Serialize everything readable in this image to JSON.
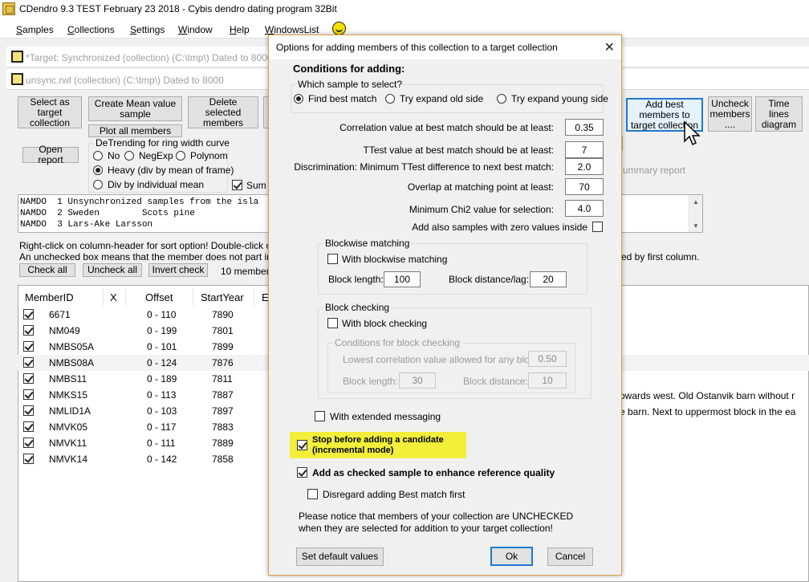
{
  "window": {
    "title": "CDendro 9.3  TEST February 23 2018 - Cybis dendro dating program  32Bit"
  },
  "menu": [
    "Samples",
    "Collections",
    "Settings",
    "Window",
    "Help",
    "WindowsList"
  ],
  "mdi": {
    "target_title": "*Target: Synchronized (collection)  (C:\\tmp\\) Dated to 8000",
    "unsync_title": "unsync.rwl (collection)  (C:\\tmp\\) Dated to 8000"
  },
  "toolbar": {
    "select_target": "Select as target collection",
    "create_mean": "Create Mean value sample",
    "plot_all": "Plot all members",
    "delete_selected": "Delete selected members",
    "open_report": "Open report",
    "add_best": "Add best members to target collection",
    "uncheck_members": "Uncheck members ....",
    "time_lines": "Time lines diagram",
    "summary_report": "ummary report",
    "sum_checkbox": "Sum b"
  },
  "detrending": {
    "title": "DeTrending for ring width curve",
    "no": "No",
    "negexp": "NegExp",
    "polynom": "Polynom",
    "heavy": "Heavy (div by mean of frame)",
    "div_individual": "Div by individual mean"
  },
  "info_lines": [
    "NAMDO  1 Unsynchronized samples from the isla",
    "NAMDO  2 Sweden        Scots pine",
    "NAMDO  3 Lars-Ake Larsson"
  ],
  "hints": {
    "line1": "Right-click on column-header for sort option! Double-click on a me",
    "line2": "An unchecked box means that the member does not part in calcula",
    "right_hint": "ed by first column."
  },
  "list_buttons": {
    "check_all": "Check all",
    "uncheck_all": "Uncheck all",
    "invert_check": "Invert check",
    "members_count": "10 members,"
  },
  "columns": [
    "MemberID",
    "X",
    "Offset",
    "StartYear",
    "E"
  ],
  "members": [
    {
      "id": "6671",
      "offset": "0 - 110",
      "start": "7890"
    },
    {
      "id": "NM049",
      "offset": "0 - 199",
      "start": "7801"
    },
    {
      "id": "NMBS05A",
      "offset": "0 - 101",
      "start": "7899"
    },
    {
      "id": "NMBS08A",
      "offset": "0 - 124",
      "start": "7876"
    },
    {
      "id": "NMBS11",
      "offset": "0 - 189",
      "start": "7811"
    },
    {
      "id": "NMKS15",
      "offset": "0 - 113",
      "start": "7887"
    },
    {
      "id": "NMLID1A",
      "offset": "0 - 103",
      "start": "7897"
    },
    {
      "id": "NMVK05",
      "offset": "0 - 117",
      "start": "7883"
    },
    {
      "id": "NMVK11",
      "offset": "0 - 111",
      "start": "7889"
    },
    {
      "id": "NMVK14",
      "offset": "0 - 142",
      "start": "7858"
    }
  ],
  "bg_text": {
    "line1": "owards west. Old Ostanvik barn without r",
    "line2": "e barn. Next to uppermost block in the ea"
  },
  "dialog": {
    "title": "Options for adding members of this collection to a target collection",
    "close": "✕",
    "conditions_header": "Conditions for adding:",
    "which_sample": "Which sample to select?",
    "opt_best": "Find best match",
    "opt_old": "Try expand old side",
    "opt_young": "Try expand young side",
    "corr_label": "Correlation value at best match should be at least:",
    "corr_value": "0.35",
    "ttest_label": "TTest value at best match should be at least:",
    "ttest_value": "7",
    "discr_label": "Discrimination: Minimum TTest difference to next best match:",
    "discr_value": "2.0",
    "overlap_label": "Overlap at matching point at least:",
    "overlap_value": "70",
    "chi2_label": "Minimum Chi2 value for selection:",
    "chi2_value": "4.0",
    "zero_values": "Add also samples with zero values inside",
    "blockwise_title": "Blockwise matching",
    "with_blockwise": "With blockwise matching",
    "block_length_label": "Block length:",
    "block_length_value": "100",
    "block_distance_label": "Block distance/lag:",
    "block_distance_value": "20",
    "blockcheck_title": "Block checking",
    "with_blockcheck": "With block checking",
    "conditions_block": "Conditions for block checking",
    "lowest_corr_label": "Lowest correlation value allowed for any block:",
    "lowest_corr_value": "0.50",
    "bc_length_label": "Block length:",
    "bc_length_value": "30",
    "bc_distance_label": "Block distance:",
    "bc_distance_value": "10",
    "extended_msg": "With extended messaging",
    "stop_before_1": "Stop before adding a candidate",
    "stop_before_2": "(incremental mode)",
    "add_checked": "Add as checked sample to enhance reference quality",
    "disregard": "Disregard adding Best match first",
    "notice_1": "Please notice that members of your collection are UNCHECKED",
    "notice_2": "when they are selected for addition to your target collection!",
    "set_default": "Set default values",
    "ok": "Ok",
    "cancel": "Cancel"
  }
}
